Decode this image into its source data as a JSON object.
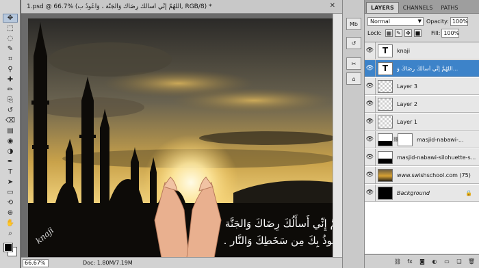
{
  "document": {
    "title": "1.psd @ 66.7% (اللَّهُمَّ إِنِّي أَسأَلُكَ رِضَاكَ وَالجَنَّة ، وَأَعُوذُ ب, RGB/8) *",
    "zoom": "66.67%",
    "doc_size": "Doc: 1.80M/7.19M"
  },
  "artwork": {
    "arabic_line1": "اللَّهُمَّ إِنِّي أَسأَلُكَ رِضَاكَ وَالجَنَّة",
    "arabic_line2": "، وَأَعُوذُ بِكَ مِن سَخَطِكَ وَالنَّار .",
    "signature": "knaji",
    "colors": {
      "sky_top": "#2b2a28",
      "glow": "#ffe9a0",
      "silhouette": "#0d0b08"
    }
  },
  "toolbox": {
    "tools": [
      "move-tool",
      "marquee-tool",
      "lasso-tool",
      "quick-select-tool",
      "crop-tool",
      "eyedropper-tool",
      "healing-tool",
      "brush-tool",
      "clone-stamp-tool",
      "history-brush-tool",
      "eraser-tool",
      "gradient-tool",
      "blur-tool",
      "dodge-tool",
      "pen-tool",
      "type-tool",
      "path-select-tool",
      "shape-tool",
      "3d-rotate-tool",
      "3d-orbit-tool",
      "hand-tool",
      "zoom-tool"
    ],
    "foreground_color": "#000000",
    "background_color": "#ffffff"
  },
  "layers_panel": {
    "tabs": [
      "LAYERS",
      "CHANNELS",
      "PATHS"
    ],
    "blend_mode": "Normal",
    "opacity_label": "Opacity:",
    "opacity": "100%",
    "lock_label": "Lock:",
    "fill_label": "Fill:",
    "fill": "100%",
    "layers": [
      {
        "name": "knaji",
        "thumb": "T",
        "selected": false
      },
      {
        "name": "اللَّهُمَّ إِنِّي أَسأَلُكَ رِضَاكَ وَ...",
        "thumb": "T",
        "selected": true
      },
      {
        "name": "Layer 3",
        "thumb": "",
        "selected": false
      },
      {
        "name": "Layer 2",
        "thumb": "",
        "selected": false
      },
      {
        "name": "Layer 1",
        "thumb": "",
        "selected": false
      },
      {
        "name": "masjid-nabawi-...",
        "thumb": "",
        "selected": false
      },
      {
        "name": "masjid-nabawi-silohuette-s...",
        "thumb": "",
        "selected": false
      },
      {
        "name": "www.swishschool.com (75)",
        "thumb": "",
        "selected": false
      },
      {
        "name": "Background",
        "thumb": "",
        "selected": false
      }
    ]
  }
}
